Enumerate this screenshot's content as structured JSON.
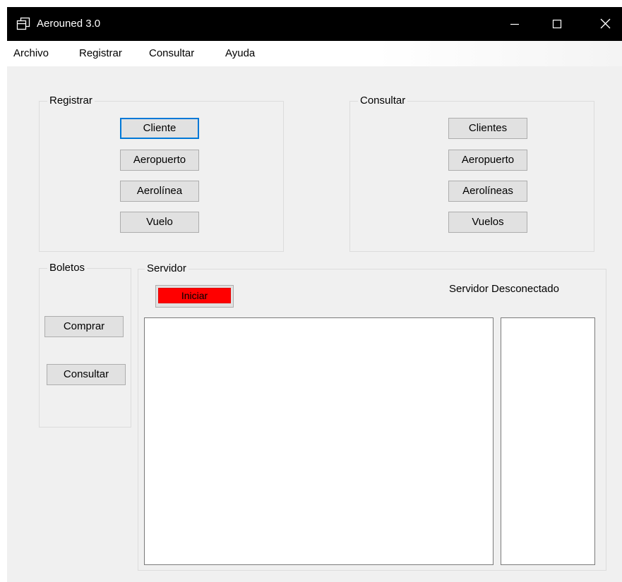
{
  "window": {
    "title": "Aerouned 3.0",
    "icon": "restore-window-icon",
    "controls": {
      "minimize_icon": "minimize-icon",
      "maximize_icon": "maximize-icon",
      "close_icon": "close-icon"
    }
  },
  "menubar": {
    "items": [
      {
        "label": "Archivo"
      },
      {
        "label": "Registrar"
      },
      {
        "label": "Consultar"
      },
      {
        "label": "Ayuda"
      }
    ]
  },
  "registrar_group": {
    "label": "Registrar",
    "buttons": [
      {
        "label": "Cliente",
        "focused": true
      },
      {
        "label": "Aeropuerto"
      },
      {
        "label": "Aerolínea"
      },
      {
        "label": "Vuelo"
      }
    ]
  },
  "consultar_group": {
    "label": "Consultar",
    "buttons": [
      {
        "label": "Clientes"
      },
      {
        "label": "Aeropuerto"
      },
      {
        "label": "Aerolíneas"
      },
      {
        "label": "Vuelos"
      }
    ]
  },
  "boletos_group": {
    "label": "Boletos",
    "buttons": [
      {
        "label": "Comprar"
      },
      {
        "label": "Consultar"
      }
    ]
  },
  "servidor_group": {
    "label": "Servidor",
    "start_button": {
      "label": "Iniciar",
      "color": "#ff0000"
    },
    "status": "Servidor Desconectado",
    "log_text": "",
    "clients_text": ""
  },
  "colors": {
    "titlebar": "#000000",
    "window_bg": "#f0f0f0",
    "focus_border": "#0078d7",
    "button_bg": "#e1e1e1"
  }
}
